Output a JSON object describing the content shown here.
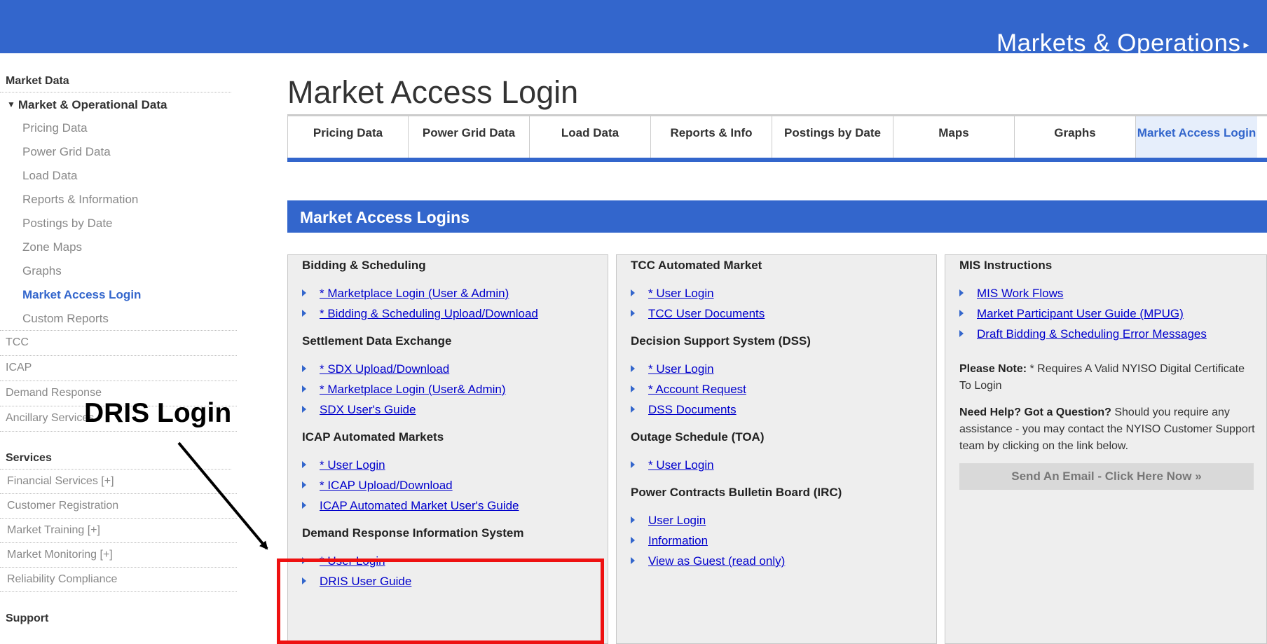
{
  "header": {
    "section_title": "Markets & Operations",
    "arrow": "▸"
  },
  "sidebar": {
    "market_data_heading": "Market Data",
    "market_ops_label": "Market & Operational Data",
    "market_ops_items": [
      "Pricing Data",
      "Power Grid Data",
      "Load Data",
      "Reports & Information",
      "Postings by Date",
      "Zone Maps",
      "Graphs",
      "Market Access Login",
      "Custom Reports"
    ],
    "top_items": [
      "TCC",
      "ICAP",
      "Demand Response",
      "Ancillary Services"
    ],
    "services_heading": "Services",
    "services_items": [
      "Financial Services [+]",
      "Customer Registration",
      "Market Training [+]",
      "Market Monitoring [+]",
      "Reliability Compliance"
    ],
    "support_heading": "Support"
  },
  "page_title": "Market Access Login",
  "tabs": [
    "Pricing Data",
    "Power Grid Data",
    "Load Data",
    "Reports & Info",
    "Postings by Date",
    "Maps",
    "Graphs",
    "Market Access Login"
  ],
  "section_bar": "Market Access Logins",
  "col1": {
    "groups": [
      {
        "title": "Bidding & Scheduling",
        "links": [
          "* Marketplace Login (User & Admin)",
          "* Bidding & Scheduling Upload/Download"
        ]
      },
      {
        "title": "Settlement Data Exchange",
        "links": [
          "* SDX Upload/Download",
          "* Marketplace Login (User& Admin)",
          "SDX User's Guide"
        ]
      },
      {
        "title": "ICAP Automated Markets",
        "links": [
          "* User Login",
          "* ICAP Upload/Download",
          "ICAP Automated Market User's Guide"
        ]
      },
      {
        "title": "Demand Response Information System",
        "links": [
          "* User Login",
          "DRIS User Guide"
        ]
      }
    ]
  },
  "col2": {
    "groups": [
      {
        "title": "TCC Automated Market",
        "links": [
          "* User Login",
          "TCC User Documents"
        ]
      },
      {
        "title": "Decision Support System (DSS)",
        "links": [
          "* User Login",
          "* Account Request",
          "DSS Documents"
        ]
      },
      {
        "title": "Outage Schedule (TOA)",
        "links": [
          "* User Login"
        ]
      },
      {
        "title": "Power Contracts Bulletin Board (IRC)",
        "links": [
          "User Login",
          "Information",
          "View as Guest (read only)"
        ]
      }
    ]
  },
  "col3": {
    "title": "MIS Instructions",
    "links": [
      "MIS Work Flows",
      "Market Participant User Guide (MPUG)",
      "Draft Bidding & Scheduling Error Messages"
    ],
    "note1_bold": "Please Note:",
    "note1_text": " * Requires A Valid NYISO Digital Certificate To Login",
    "note2_bold": "Need Help? Got a Question?",
    "note2_text": " Should you require any assistance - you may contact the NYISO Customer Support team by clicking on the link below.",
    "email_button": "Send An Email - Click Here Now »"
  },
  "annotation": {
    "label": "DRIS Login",
    "color": "#ee1111"
  },
  "colors": {
    "brand_blue": "#3366cc",
    "link": "#0000cc"
  }
}
